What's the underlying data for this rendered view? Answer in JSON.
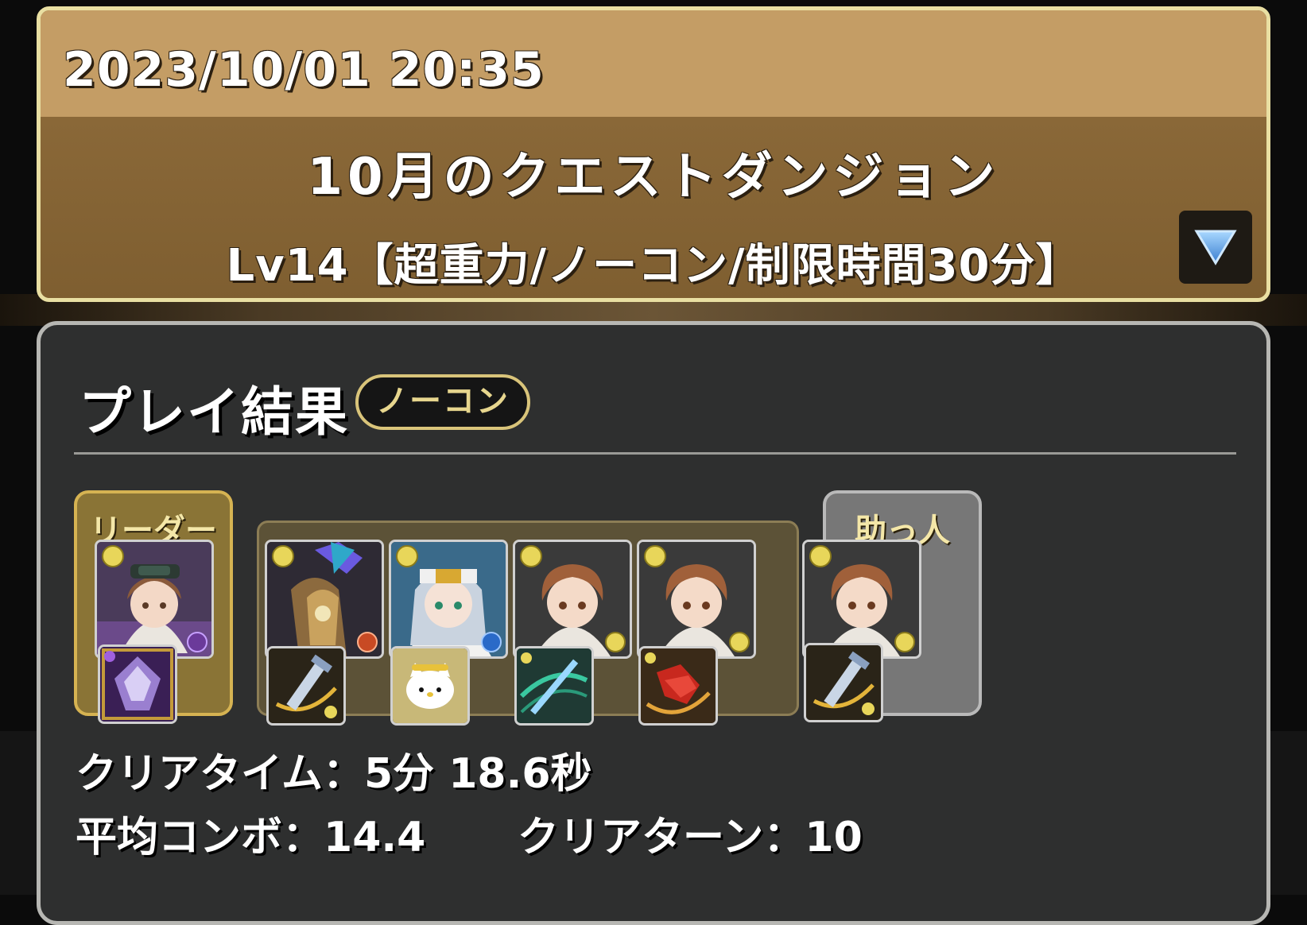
{
  "header": {
    "timestamp": "2023/10/01 20:35",
    "dungeon_title": "10月のクエストダンジョン",
    "floor_title": "Lv14【超重力/ノーコン/制限時間30分】",
    "expand_icon": "triangle-down-icon"
  },
  "result": {
    "title": "プレイ結果",
    "badge": "ノーコン",
    "leader_label": "リーダー",
    "helper_label": "助っ人",
    "team": [
      {
        "role": "leader",
        "monster": "misaka-goggles-portrait",
        "attribute": "light",
        "sub_attribute": "dark",
        "assist": "purple-dragon-assist"
      },
      {
        "role": "sub",
        "monster": "armored-dragon-portrait",
        "attribute": "light",
        "sub_attribute": "fire",
        "assist": "shining-rod-assist"
      },
      {
        "role": "sub",
        "monster": "index-nun-portrait",
        "attribute": "light",
        "sub_attribute": "water",
        "assist": "hello-kitty-assist"
      },
      {
        "role": "sub",
        "monster": "misaka-portrait",
        "attribute": "light",
        "sub_attribute": "light",
        "assist": "green-sword-assist"
      },
      {
        "role": "sub",
        "monster": "misaka-portrait",
        "attribute": "light",
        "sub_attribute": "light",
        "assist": "red-gloves-assist"
      },
      {
        "role": "helper",
        "monster": "misaka-portrait",
        "attribute": "light",
        "sub_attribute": "light",
        "assist": "shining-rod-assist"
      }
    ],
    "clear_time_label": "クリアタイム：",
    "clear_time_value": "5分 18.6秒",
    "avg_combo_label": "平均コンボ：",
    "avg_combo_value": "14.4",
    "clear_turn_label": "クリアターン：",
    "clear_turn_value": "10"
  },
  "colors": {
    "header_top": "#c49d65",
    "header_bottom": "#8a6838",
    "panel": "#2e2f2f",
    "badge_text": "#e7d68e",
    "leader_frame": "#d6b352"
  }
}
